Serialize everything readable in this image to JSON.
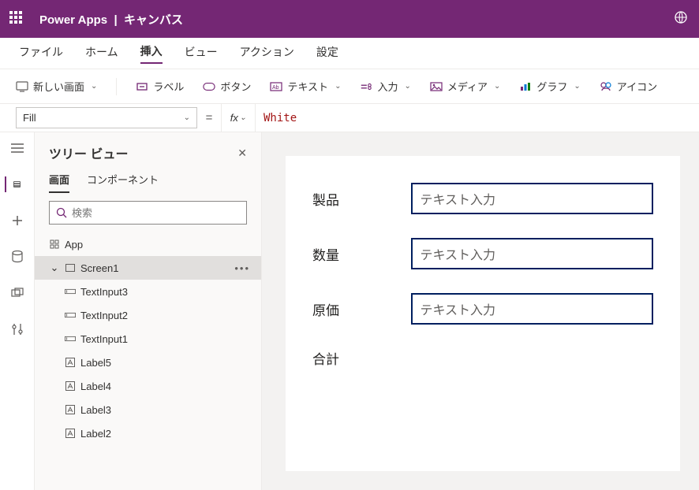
{
  "header": {
    "product": "Power Apps",
    "separator": "|",
    "context": "キャンバス"
  },
  "menu": {
    "file": "ファイル",
    "home": "ホーム",
    "insert": "挿入",
    "view": "ビュー",
    "action": "アクション",
    "settings": "設定",
    "active": "insert"
  },
  "toolbar": {
    "newscreen": "新しい画面",
    "label": "ラベル",
    "button": "ボタン",
    "text": "テキスト",
    "input": "入力",
    "media": "メディア",
    "chart": "グラフ",
    "icons": "アイコン"
  },
  "formula": {
    "property": "Fill",
    "value": "White"
  },
  "tree": {
    "title": "ツリー ビュー",
    "tabs": {
      "screens": "画面",
      "components": "コンポーネント"
    },
    "search_placeholder": "検索",
    "items": [
      {
        "name": "App",
        "type": "app",
        "level": 1
      },
      {
        "name": "Screen1",
        "type": "screen",
        "level": 1,
        "selected": true,
        "expanded": true
      },
      {
        "name": "TextInput3",
        "type": "textinput",
        "level": 2
      },
      {
        "name": "TextInput2",
        "type": "textinput",
        "level": 2
      },
      {
        "name": "TextInput1",
        "type": "textinput",
        "level": 2
      },
      {
        "name": "Label5",
        "type": "label",
        "level": 2
      },
      {
        "name": "Label4",
        "type": "label",
        "level": 2
      },
      {
        "name": "Label3",
        "type": "label",
        "level": 2
      },
      {
        "name": "Label2",
        "type": "label",
        "level": 2
      }
    ]
  },
  "canvas": {
    "labels": {
      "product": "製品",
      "quantity": "数量",
      "cost": "原価",
      "total": "合計"
    },
    "input_placeholder": "テキスト入力"
  }
}
